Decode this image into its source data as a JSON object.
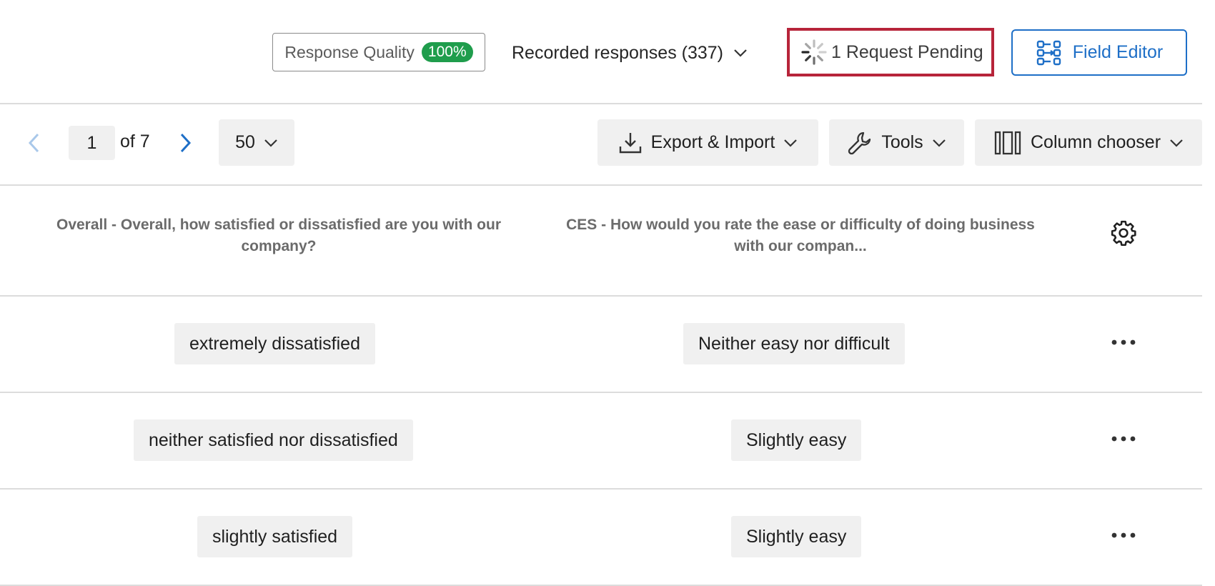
{
  "header": {
    "response_quality_label": "Response Quality",
    "response_quality_badge": "100%",
    "recorded_label": "Recorded responses (337)",
    "pending_label": "1 Request Pending",
    "field_editor_label": "Field Editor"
  },
  "toolbar": {
    "page_value": "1",
    "page_of": "of 7",
    "per_page": "50",
    "export_label": "Export & Import",
    "tools_label": "Tools",
    "column_chooser_label": "Column chooser"
  },
  "table": {
    "columns": [
      "Overall - Overall, how satisfied or dissatisfied are you with our company?",
      "CES - How would you rate the ease or difficulty of doing business with our compan..."
    ],
    "rows": [
      [
        "extremely dissatisfied",
        "Neither easy nor difficult"
      ],
      [
        "neither satisfied nor dissatisfied",
        "Slightly easy"
      ],
      [
        "slightly satisfied",
        "Slightly easy"
      ]
    ]
  },
  "colors": {
    "accent": "#1e6fc7",
    "badge_green": "#1f9d4c",
    "highlight_red": "#b7243a"
  },
  "icons": {
    "spinner": "loading-spinner-icon",
    "field_editor": "field-editor-icon",
    "export": "download-icon",
    "tools": "wrench-icon",
    "columns": "columns-icon",
    "settings": "gear-icon",
    "row_actions": "more-horizontal-icon"
  }
}
